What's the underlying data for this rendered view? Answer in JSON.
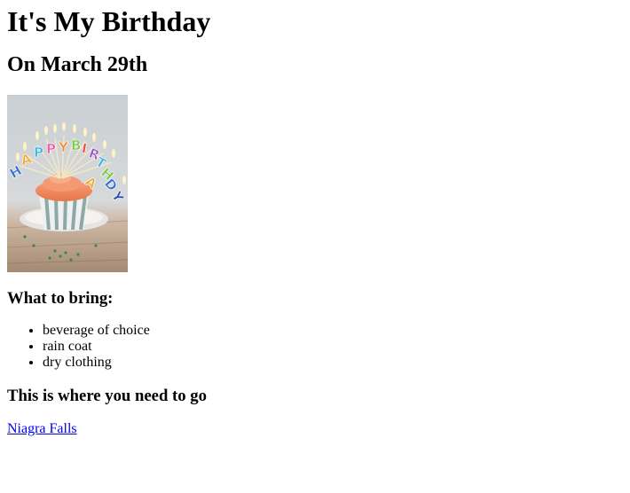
{
  "page": {
    "title": "It's My Birthday",
    "date_heading": "On March 29th",
    "photo": {
      "icon": "birthday-cupcake-photo",
      "candle_letters": "HAPPY BIRTHDAY"
    },
    "bring_heading": "What to bring:",
    "bring_items": [
      "beverage of choice",
      "rain coat",
      "dry clothing"
    ],
    "location_heading": "This is where you need to go",
    "location_link": "Niagra Falls"
  }
}
